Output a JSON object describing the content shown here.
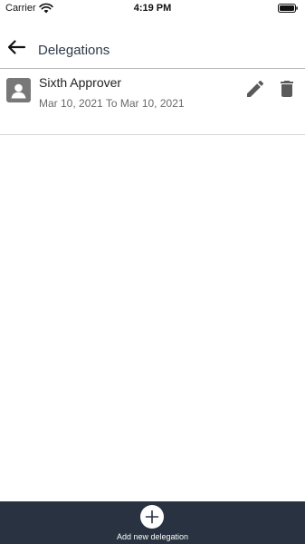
{
  "status_bar": {
    "carrier": "Carrier",
    "time": "4:19 PM",
    "icons": [
      "wifi-icon",
      "battery-icon"
    ]
  },
  "header": {
    "title": "Delegations",
    "back_icon": "arrow-left-icon"
  },
  "delegations": [
    {
      "name": "Sixth Approver",
      "dates": "Mar 10, 2021 To Mar 10, 2021",
      "avatar_icon": "user-icon",
      "actions": [
        "pencil-icon",
        "trash-icon"
      ]
    }
  ],
  "footer": {
    "add_label": "Add new delegation",
    "add_icon": "plus-circle-icon"
  },
  "colors": {
    "footer_bg": "#283240",
    "title_text": "#2d3a4a",
    "icon_gray": "#5a5a5a",
    "avatar_bg": "#787878"
  }
}
